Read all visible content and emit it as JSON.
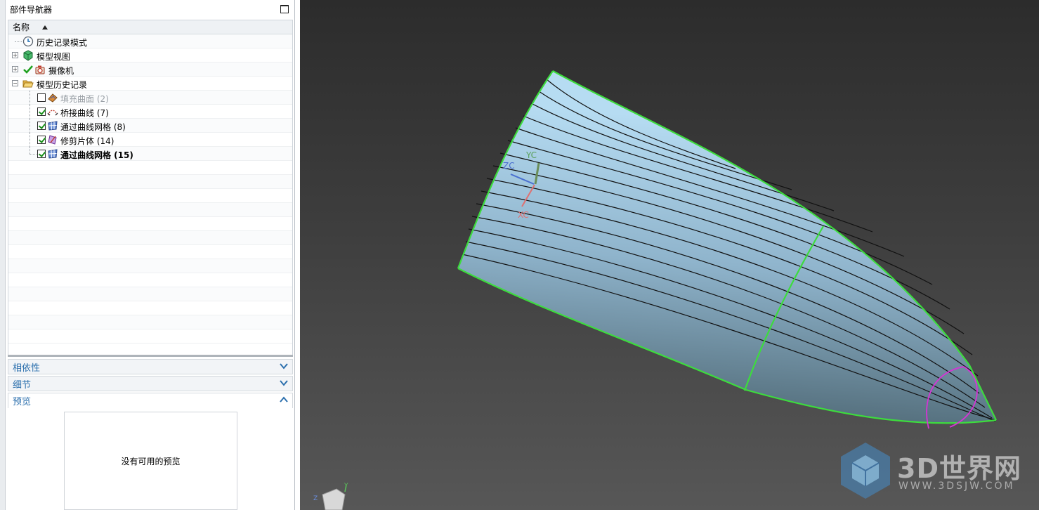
{
  "navigator": {
    "title": "部件导航器",
    "column_header": "名称",
    "tree": [
      {
        "label": "历史记录模式",
        "icon": "clock-icon"
      },
      {
        "label": "模型视图",
        "icon": "model-view-icon",
        "expander": "+"
      },
      {
        "label": "摄像机",
        "icon": "camera-icon",
        "expander": "+",
        "checkmark": true
      },
      {
        "label": "模型历史记录",
        "icon": "folder-open-icon",
        "expander": "−"
      },
      {
        "label": "填充曲面 (2)",
        "icon": "fill-surface-icon",
        "checked": false,
        "disabled": true
      },
      {
        "label": "桥接曲线 (7)",
        "icon": "bridge-curve-icon",
        "checked": true
      },
      {
        "label": "通过曲线网格 (8)",
        "icon": "curve-mesh-icon",
        "checked": true
      },
      {
        "label": "修剪片体 (14)",
        "icon": "trim-sheet-icon",
        "checked": true
      },
      {
        "label": "通过曲线网格 (15)",
        "icon": "curve-mesh-icon",
        "checked": true,
        "current": true
      }
    ],
    "sections": {
      "dependencies": "相依性",
      "details": "细节",
      "preview": "预览"
    },
    "preview_empty": "没有可用的预览"
  },
  "viewport": {
    "wcs_labels": {
      "yc": "YC",
      "zc": "ZC",
      "xc": "XC"
    },
    "triad_labels": {
      "z": "Z",
      "y": "Y"
    },
    "colors": {
      "surface_edge": "#3ddc3d",
      "trim_curve": "#d633d6",
      "surface_fill": "#a9d6ee",
      "background": "#3a3a3a"
    }
  },
  "watermark": {
    "title": "3D世界网",
    "url": "WWW.3DSJW.COM"
  }
}
